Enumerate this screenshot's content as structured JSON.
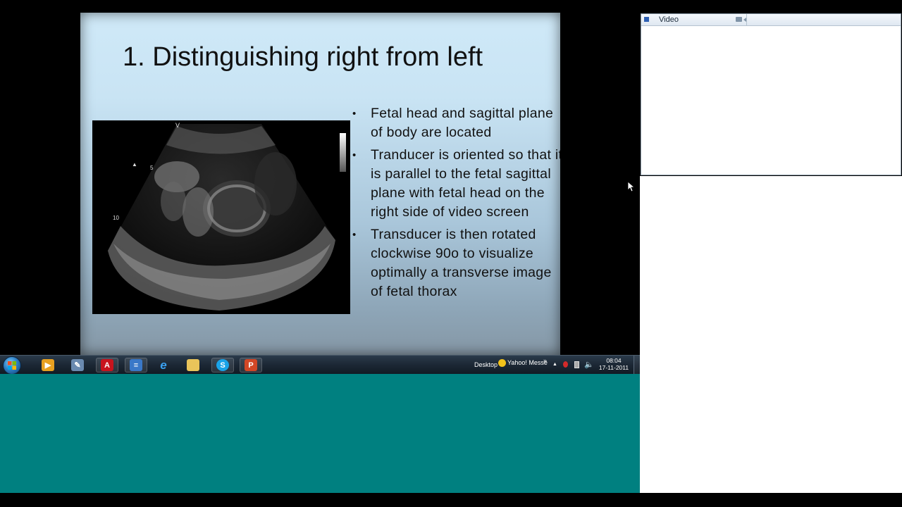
{
  "slide": {
    "title": "1. Distinguishing right from left",
    "bullets": [
      "Fetal head and sagittal plane of body are located",
      "Tranducer is oriented so that it is parallel to the fetal sagittal plane with fetal head on the right side of video screen",
      "Transducer is then rotated clockwise 90o to visualize optimally a transverse image of fetal thorax"
    ],
    "image_marks": [
      "V",
      "5",
      "10"
    ]
  },
  "taskbar": {
    "icons": [
      "start-orb",
      "media-player",
      "wrench",
      "adobe-reader",
      "notepad",
      "internet-explorer",
      "file-explorer",
      "skype",
      "powerpoint"
    ],
    "desktop_label": "Desktop",
    "yahoo_label": "Yahoo! Messe",
    "overflow": "»",
    "tray_arrow": "▲",
    "time": "08:04",
    "date": "17-11-2011"
  },
  "video_window": {
    "title": "Video"
  },
  "colors": {
    "desktop": "#008080",
    "taskbar": "#1c2835"
  }
}
